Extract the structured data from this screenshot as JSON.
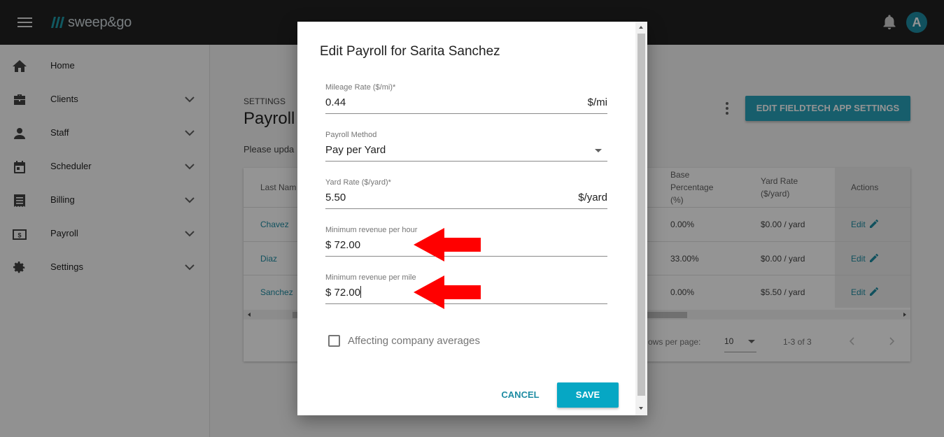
{
  "app": {
    "brand": "sweep&go",
    "avatar_initial": "A",
    "accent": "#1e8ca3"
  },
  "sidebar": {
    "items": [
      {
        "label": "Home",
        "icon": "home-icon",
        "has_chevron": false
      },
      {
        "label": "Clients",
        "icon": "briefcase-icon",
        "has_chevron": true
      },
      {
        "label": "Staff",
        "icon": "person-icon",
        "has_chevron": true
      },
      {
        "label": "Scheduler",
        "icon": "calendar-icon",
        "has_chevron": true
      },
      {
        "label": "Billing",
        "icon": "receipt-icon",
        "has_chevron": true
      },
      {
        "label": "Payroll",
        "icon": "money-icon",
        "has_chevron": true
      },
      {
        "label": "Settings",
        "icon": "gear-icon",
        "has_chevron": true
      }
    ]
  },
  "page": {
    "section_label": "SETTINGS",
    "title": "Payroll",
    "intro": "Please upda",
    "fieldtech_button": "EDIT FIELDTECH APP SETTINGS"
  },
  "table": {
    "headers": {
      "last_name": "Last Nam",
      "base_percentage": "Base Percentage (%)",
      "yard_rate": "Yard Rate ($/yard)",
      "actions": "Actions"
    },
    "rows": [
      {
        "last_name": "Chavez",
        "base_percentage": "0.00%",
        "yard_rate": "$0.00 / yard",
        "action": "Edit"
      },
      {
        "last_name": "Diaz",
        "base_percentage": "33.00%",
        "yard_rate": "$0.00 / yard",
        "action": "Edit"
      },
      {
        "last_name": "Sanchez",
        "base_percentage": "0.00%",
        "yard_rate": "$5.50 / yard",
        "action": "Edit"
      }
    ],
    "footer": {
      "rows_per_page_label": "ows per page:",
      "rows_per_page": "10",
      "range": "1-3 of 3"
    }
  },
  "dialog": {
    "title": "Edit Payroll for Sarita Sanchez",
    "fields": {
      "mileage_rate": {
        "label": "Mileage Rate ($/mi)*",
        "value": "0.44",
        "suffix": "$/mi"
      },
      "payroll_method": {
        "label": "Payroll Method",
        "value": "Pay per Yard"
      },
      "yard_rate": {
        "label": "Yard Rate ($/yard)*",
        "value": "5.50",
        "suffix": "$/yard"
      },
      "min_revenue_hour": {
        "label": "Minimum revenue per hour",
        "value": "$ 72.00"
      },
      "min_revenue_mile": {
        "label": "Minimum revenue per mile",
        "value": "$ 72.00"
      }
    },
    "checkbox_label": "Affecting company averages",
    "checkbox_checked": false,
    "cancel_label": "CANCEL",
    "save_label": "SAVE",
    "annotation_arrow_color": "#ff0000"
  }
}
